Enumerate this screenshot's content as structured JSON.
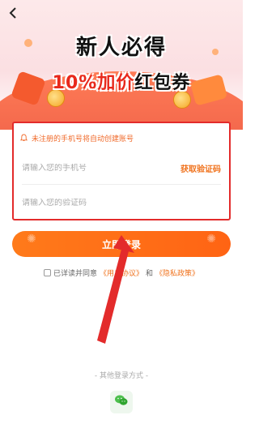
{
  "hero": {
    "title_line1": "新人必得",
    "title_line2_a": "10%加价",
    "title_line2_b": "红包券"
  },
  "form": {
    "notice_text": "未注册的手机号将自动创建账号",
    "phone_placeholder": "请输入您的手机号",
    "get_code_label": "获取验证码",
    "code_placeholder": "请输入您的验证码"
  },
  "login": {
    "button_label": "立即登录"
  },
  "agreement": {
    "prefix": "已详读并同意",
    "user_agreement": "《用户协议》",
    "and": "和",
    "privacy_policy": "《隐私政策》"
  },
  "other_login": {
    "label": "- 其他登录方式 -",
    "wechat_icon": "wechat-icon"
  },
  "colors": {
    "accent": "#ff6a1a",
    "highlight_border": "#e32b2b",
    "link": "#f0731e"
  }
}
